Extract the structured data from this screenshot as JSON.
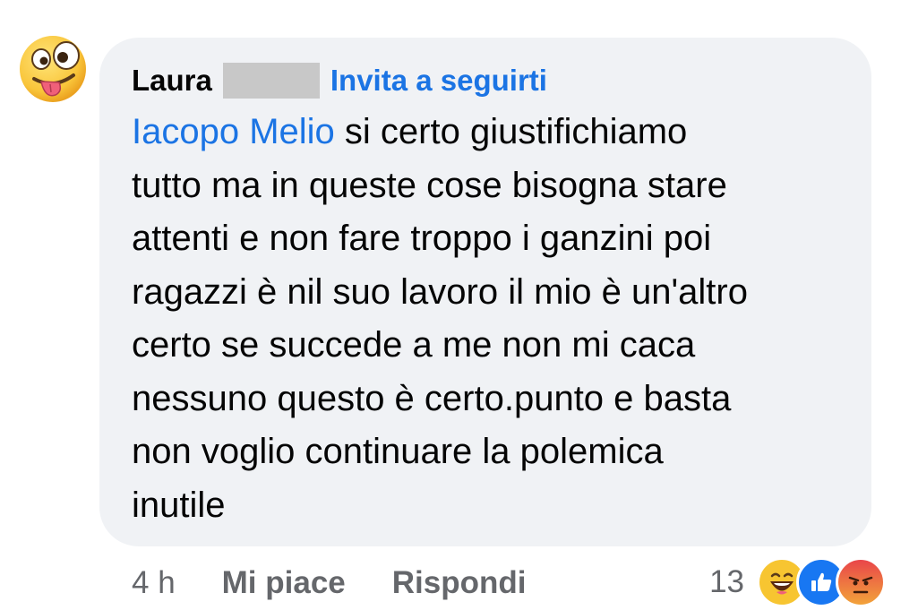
{
  "comment": {
    "author": "Laura",
    "follow_label": "Invita a seguirti",
    "mention": "Iacopo Melio",
    "lines": [
      " si certo giustifichiamo",
      "tutto ma in queste cose bisogna stare",
      "attenti e non fare troppo i ganzini poi",
      "ragazzi è nil suo lavoro il mio è un'altro",
      "certo se succede a me non mi caca",
      "nessuno questo è certo.punto e basta",
      "non voglio continuare la polemica",
      "inutile"
    ]
  },
  "actions": {
    "timestamp": "4 h",
    "like_label": "Mi piace",
    "reply_label": "Rispondi"
  },
  "reactions": {
    "count": "13",
    "icons": [
      "haha-icon",
      "like-icon",
      "angry-icon"
    ]
  },
  "colors": {
    "bubble": "#f0f2f5",
    "link": "#1b74e4",
    "text": "#050505",
    "muted": "#65676b",
    "like_blue": "#1877f2",
    "emoji_yellow": "#f7c531",
    "angry_red": "#e9710f"
  },
  "avatar": {
    "icon": "crazy-face-emoji"
  }
}
